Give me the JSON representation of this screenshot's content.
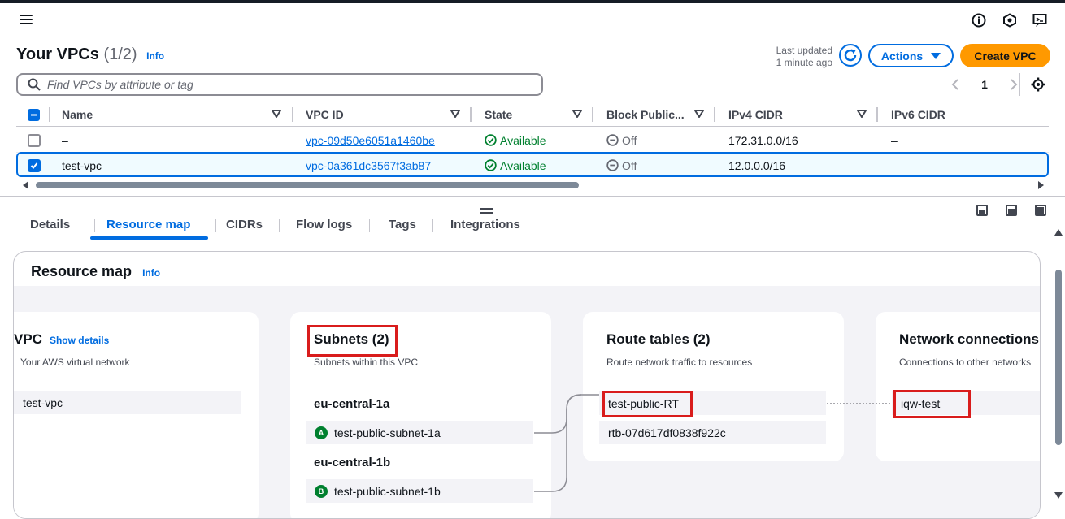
{
  "header": {
    "title": "Your VPCs",
    "count": "(1/2)",
    "info": "Info",
    "last_updated_line1": "Last updated",
    "last_updated_line2": "1 minute ago",
    "actions_label": "Actions",
    "create_label": "Create VPC"
  },
  "search": {
    "placeholder": "Find VPCs by attribute or tag"
  },
  "pagination": {
    "page": "1"
  },
  "table": {
    "columns": [
      "Name",
      "VPC ID",
      "State",
      "Block Public...",
      "IPv4 CIDR",
      "IPv6 CIDR"
    ],
    "rows": [
      {
        "name": "–",
        "vpc_id": "vpc-09d50e6051a1460be",
        "state": "Available",
        "block": "Off",
        "ipv4": "172.31.0.0/16",
        "ipv6": "–",
        "selected": false
      },
      {
        "name": "test-vpc",
        "vpc_id": "vpc-0a361dc3567f3ab87",
        "state": "Available",
        "block": "Off",
        "ipv4": "12.0.0.0/16",
        "ipv6": "–",
        "selected": true
      }
    ]
  },
  "tabs": [
    "Details",
    "Resource map",
    "CIDRs",
    "Flow logs",
    "Tags",
    "Integrations"
  ],
  "resource_map": {
    "title": "Resource map",
    "info": "Info",
    "vpc": {
      "title": "VPC",
      "show_details": "Show details",
      "subtitle": "Your AWS virtual network",
      "item": "test-vpc"
    },
    "subnets": {
      "title": "Subnets (2)",
      "subtitle": "Subnets within this VPC",
      "zones": [
        {
          "name": "eu-central-1a",
          "badge": "A",
          "subnet": "test-public-subnet-1a"
        },
        {
          "name": "eu-central-1b",
          "badge": "B",
          "subnet": "test-public-subnet-1b"
        }
      ]
    },
    "route_tables": {
      "title": "Route tables (2)",
      "subtitle": "Route network traffic to resources",
      "items": [
        "test-public-RT",
        "rtb-07d617df0838f922c"
      ]
    },
    "network": {
      "title": "Network connections",
      "subtitle": "Connections to other networks",
      "items": [
        "iqw-test"
      ]
    }
  },
  "colors": {
    "accent": "#006ce0",
    "primary_button": "#ff9900",
    "success": "#00802f",
    "highlight_box": "#d91c1c"
  }
}
